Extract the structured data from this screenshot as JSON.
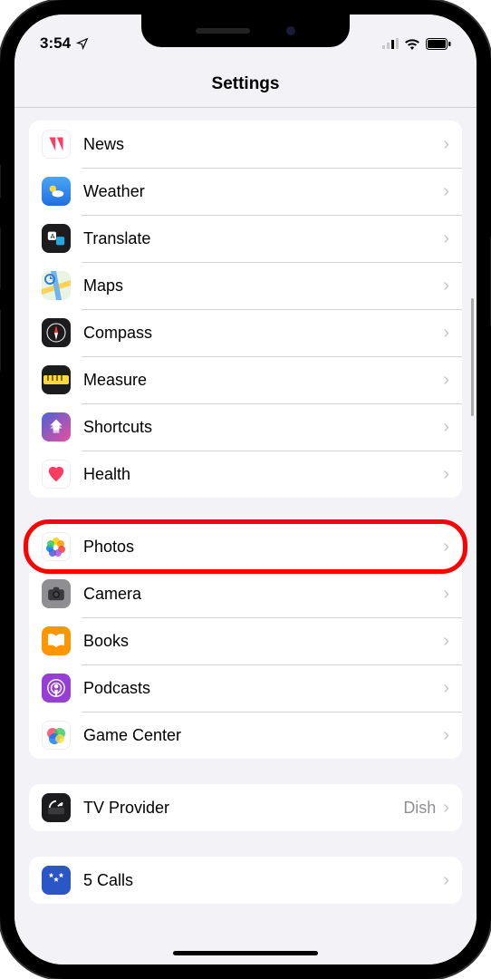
{
  "status": {
    "time": "3:54",
    "location_icon": "location-arrow",
    "signal_icon": "cell-signal",
    "wifi_icon": "wifi",
    "battery_icon": "battery-full"
  },
  "header": {
    "title": "Settings"
  },
  "groups": [
    {
      "items": [
        {
          "icon": "news-icon",
          "label": "News"
        },
        {
          "icon": "weather-icon",
          "label": "Weather"
        },
        {
          "icon": "translate-icon",
          "label": "Translate"
        },
        {
          "icon": "maps-icon",
          "label": "Maps"
        },
        {
          "icon": "compass-icon",
          "label": "Compass"
        },
        {
          "icon": "measure-icon",
          "label": "Measure"
        },
        {
          "icon": "shortcuts-icon",
          "label": "Shortcuts"
        },
        {
          "icon": "health-icon",
          "label": "Health"
        }
      ]
    },
    {
      "items": [
        {
          "icon": "photos-icon",
          "label": "Photos",
          "highlighted": true
        },
        {
          "icon": "camera-icon",
          "label": "Camera"
        },
        {
          "icon": "books-icon",
          "label": "Books"
        },
        {
          "icon": "podcasts-icon",
          "label": "Podcasts"
        },
        {
          "icon": "gamecenter-icon",
          "label": "Game Center"
        }
      ]
    },
    {
      "items": [
        {
          "icon": "tvprovider-icon",
          "label": "TV Provider",
          "value": "Dish"
        }
      ]
    },
    {
      "items": [
        {
          "icon": "5calls-icon",
          "label": "5 Calls"
        }
      ]
    }
  ]
}
